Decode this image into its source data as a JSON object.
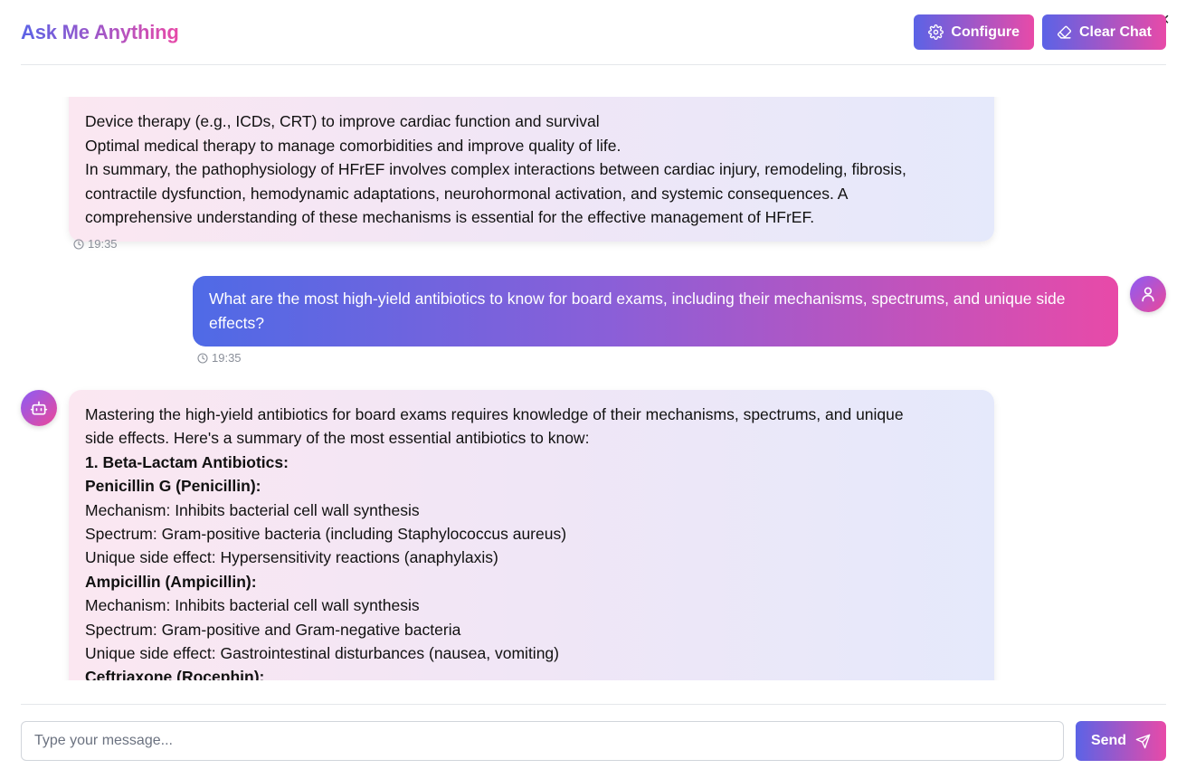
{
  "header": {
    "title": "Ask Me Anything",
    "configure_label": "Configure",
    "clear_label": "Clear Chat",
    "close_glyph": "×"
  },
  "messages": [
    {
      "role": "assistant",
      "lines": [
        {
          "text": "Device therapy (e.g., ICDs, CRT) to improve cardiac function and survival",
          "bold": false
        },
        {
          "text": "Optimal medical therapy to manage comorbidities and improve quality of life.",
          "bold": false
        },
        {
          "text": "In summary, the pathophysiology of HFrEF involves complex interactions between cardiac injury, remodeling, fibrosis,",
          "bold": false
        },
        {
          "text": "contractile dysfunction, hemodynamic adaptations, neurohormonal activation, and systemic consequences. A",
          "bold": false
        },
        {
          "text": "comprehensive understanding of these mechanisms is essential for the effective management of HFrEF.",
          "bold": false
        }
      ],
      "time": "19:35"
    },
    {
      "role": "user",
      "text": "What are the most high-yield antibiotics to know for board exams, including their mechanisms, spectrums, and unique side effects?",
      "time": "19:35"
    },
    {
      "role": "assistant",
      "lines": [
        {
          "text": "Mastering the high-yield antibiotics for board exams requires knowledge of their mechanisms, spectrums, and unique",
          "bold": false
        },
        {
          "text": "side effects. Here's a summary of the most essential antibiotics to know:",
          "bold": false
        },
        {
          "text": "1. Beta-Lactam Antibiotics:",
          "bold": true
        },
        {
          "text": "Penicillin G (Penicillin):",
          "bold": true
        },
        {
          "text": "Mechanism: Inhibits bacterial cell wall synthesis",
          "bold": false
        },
        {
          "text": "Spectrum: Gram-positive bacteria (including Staphylococcus aureus)",
          "bold": false
        },
        {
          "text": "Unique side effect: Hypersensitivity reactions (anaphylaxis)",
          "bold": false
        },
        {
          "text": "Ampicillin (Ampicillin):",
          "bold": true
        },
        {
          "text": "Mechanism: Inhibits bacterial cell wall synthesis",
          "bold": false
        },
        {
          "text": "Spectrum: Gram-positive and Gram-negative bacteria",
          "bold": false
        },
        {
          "text": "Unique side effect: Gastrointestinal disturbances (nausea, vomiting)",
          "bold": false
        },
        {
          "text": "Ceftriaxone (Rocephin):",
          "bold": true
        }
      ]
    }
  ],
  "composer": {
    "placeholder": "Type your message...",
    "send_label": "Send"
  },
  "icons": {
    "configure": "gear-icon",
    "clear": "eraser-icon",
    "clock": "clock-icon",
    "user_avatar": "user-icon",
    "bot_avatar": "bot-icon",
    "send": "send-icon"
  },
  "colors": {
    "gradient_start": "#5b63e6",
    "gradient_end": "#e84aa8"
  }
}
